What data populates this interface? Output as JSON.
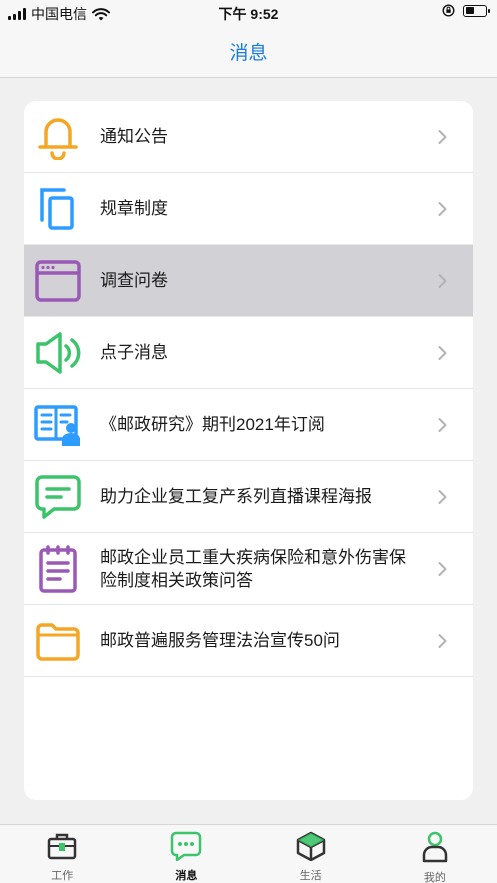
{
  "status_bar": {
    "carrier": "中国电信",
    "time": "下午 9:52",
    "battery_level": 0.45
  },
  "nav": {
    "title": "消息"
  },
  "menu": {
    "items": [
      {
        "label": "通知公告",
        "icon": "bell-icon",
        "color": "#f5a623"
      },
      {
        "label": "规章制度",
        "icon": "copy-docs-icon",
        "color": "#2d9cff"
      },
      {
        "label": "调查问卷",
        "icon": "browser-window-icon",
        "color": "#9b59b6",
        "selected": true
      },
      {
        "label": "点子消息",
        "icon": "speaker-icon",
        "color": "#3cc46a"
      },
      {
        "label": "《邮政研究》期刊2021年订阅",
        "icon": "reader-icon",
        "color": "#2d9cff"
      },
      {
        "label": "助力企业复工复产系列直播课程海报",
        "icon": "chat-bubble-icon",
        "color": "#3cc46a"
      },
      {
        "label": "邮政企业员工重大疾病保险和意外伤害保险制度相关政策问答",
        "icon": "notepad-icon",
        "color": "#9b59b6"
      },
      {
        "label": "邮政普遍服务管理法治宣传50问",
        "icon": "folder-icon",
        "color": "#f5a623"
      }
    ]
  },
  "tabs": [
    {
      "label": "工作",
      "icon": "briefcase-icon"
    },
    {
      "label": "消息",
      "icon": "message-icon",
      "active": true
    },
    {
      "label": "生活",
      "icon": "cube-icon"
    },
    {
      "label": "我的",
      "icon": "person-icon"
    }
  ],
  "colors": {
    "accent_blue": "#1a7be0",
    "active_green": "#3cc46a"
  }
}
